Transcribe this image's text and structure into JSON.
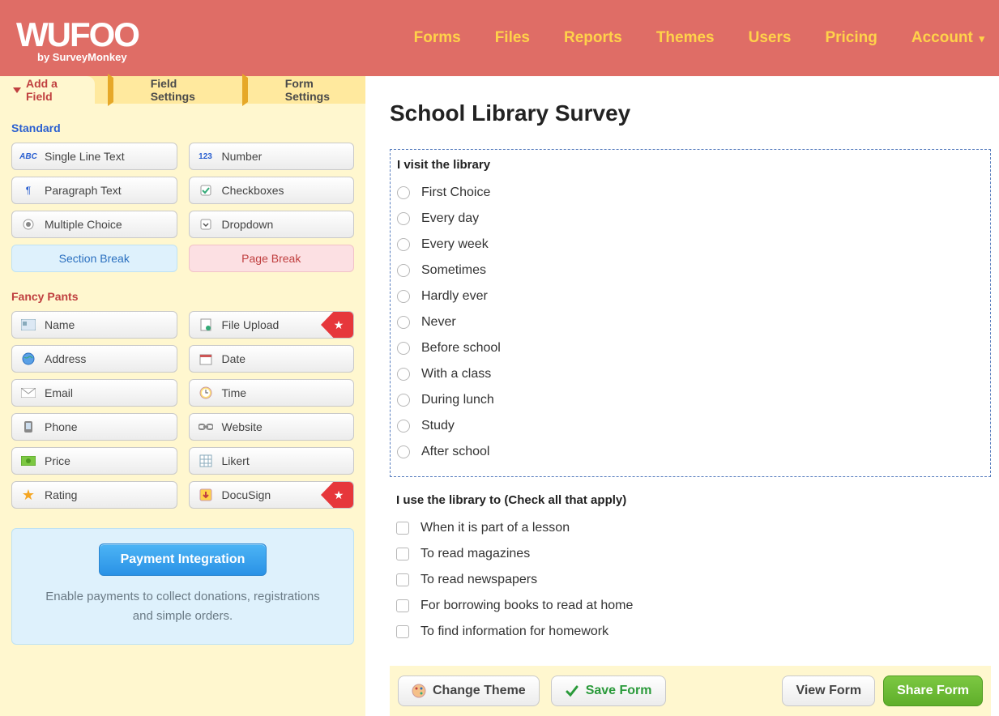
{
  "logo": {
    "word": "WUFOO",
    "sub": "by SurveyMonkey"
  },
  "topnav": {
    "forms": "Forms",
    "files": "Files",
    "reports": "Reports",
    "themes": "Themes",
    "users": "Users",
    "pricing": "Pricing",
    "account": "Account"
  },
  "subtabs": {
    "add_field": "Add a Field",
    "field_settings": "Field Settings",
    "form_settings": "Form Settings"
  },
  "sections": {
    "standard": "Standard",
    "fancy": "Fancy Pants"
  },
  "fields": {
    "single_line": "Single Line Text",
    "number": "Number",
    "paragraph": "Paragraph Text",
    "checkboxes": "Checkboxes",
    "multiple_choice": "Multiple Choice",
    "dropdown": "Dropdown",
    "section_break": "Section Break",
    "page_break": "Page Break",
    "name": "Name",
    "file_upload": "File Upload",
    "address": "Address",
    "date": "Date",
    "email": "Email",
    "time": "Time",
    "phone": "Phone",
    "website": "Website",
    "price": "Price",
    "likert": "Likert",
    "rating": "Rating",
    "docusign": "DocuSign"
  },
  "payment": {
    "button": "Payment Integration",
    "desc": "Enable payments to collect donations, registrations and simple orders."
  },
  "form": {
    "title": "School Library Survey",
    "q1": {
      "label": "I visit the library",
      "options": [
        "First Choice",
        "Every day",
        "Every week",
        "Sometimes",
        "Hardly ever",
        "Never",
        "Before school",
        "With a class",
        "During lunch",
        "Study",
        "After school"
      ]
    },
    "q2": {
      "label": "I use the library to (Check all that apply)",
      "options": [
        "When it is part of a lesson",
        "To read magazines",
        "To read newspapers",
        "For borrowing books to read at home",
        "To find information for homework"
      ]
    }
  },
  "bottom": {
    "change_theme": "Change Theme",
    "save_form": "Save Form",
    "view_form": "View Form",
    "share_form": "Share Form"
  }
}
